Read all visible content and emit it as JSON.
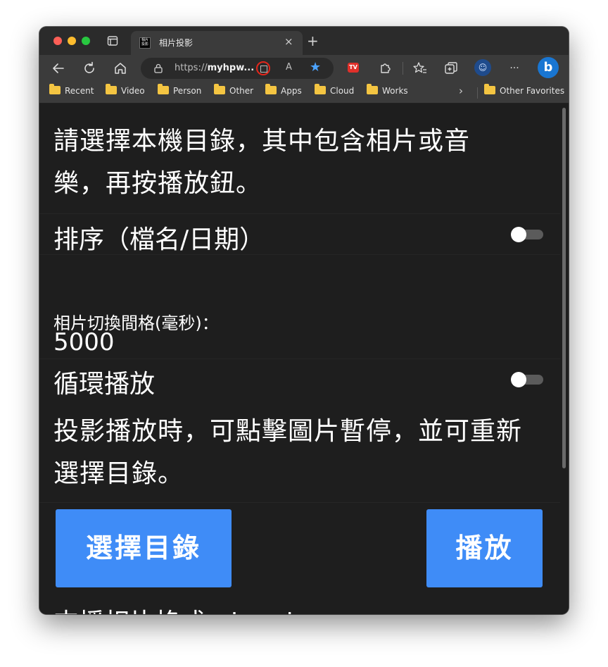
{
  "browser": {
    "tab": {
      "title": "相片投影",
      "favicon_text": "相片投影",
      "close": "×"
    },
    "new_tab": "+",
    "url": {
      "prefix": "https://",
      "host": "myhpw..."
    },
    "read_aloud": "A",
    "tv_badge": "TV",
    "bookmarks": [
      "Recent",
      "Video",
      "Person",
      "Other",
      "Apps",
      "Cloud",
      "Works"
    ],
    "other_favorites": "Other Favorites",
    "more": "···"
  },
  "page": {
    "intro": "請選擇本機目錄，其中包含相片或音樂，再按播放鈕。",
    "sort_label": "排序（檔名/日期）",
    "sort_toggle_on": false,
    "interval_label": "相片切換間格(毫秒)：",
    "interval_value": "5000",
    "loop_label": "循環播放",
    "loop_toggle_on": false,
    "hint": "投影播放時，可點擊圖片暫停，並可重新選擇目錄。",
    "choose_dir_button": "選擇目錄",
    "play_button": "播放",
    "formats_text": "支援相片格式：jpg, jpeg, svg, png,"
  },
  "colors": {
    "page_bg": "#1e1e1e",
    "button_blue": "#3f8cf7",
    "highlight_circle": "#e3261b"
  }
}
